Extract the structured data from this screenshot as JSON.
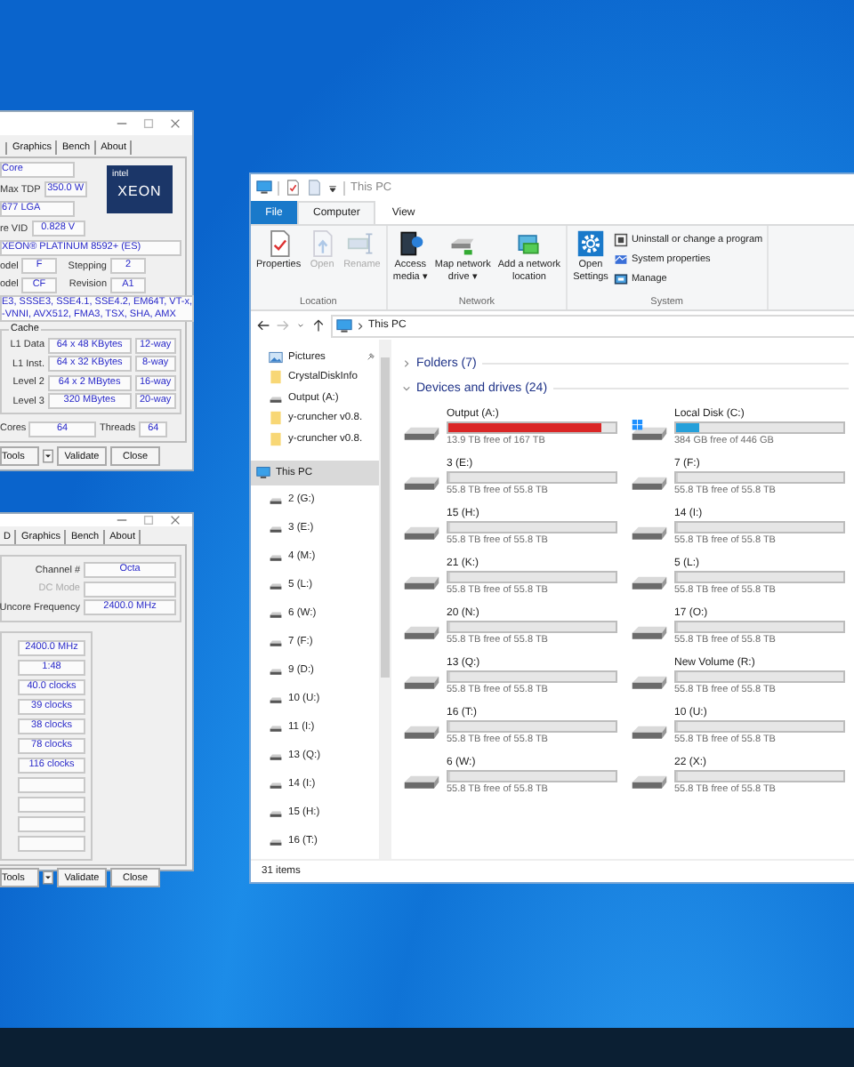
{
  "cpu_window": {
    "tabs": [
      "Graphics",
      "Bench",
      "About"
    ],
    "code_name": "Core",
    "max_tdp": {
      "label": "Max TDP",
      "value": "350.0 W"
    },
    "package": "677 LGA",
    "vid": {
      "label": "re VID",
      "value": "0.828 V"
    },
    "logo": {
      "brand": "intel",
      "name": "XEON"
    },
    "specification": "XEON® PLATINUM 8592+ (ES)",
    "model": {
      "label": "odel",
      "value": "F"
    },
    "stepping": {
      "label": "Stepping",
      "value": "2"
    },
    "ext_model": {
      "label": "odel",
      "value": "CF"
    },
    "revision": {
      "label": "Revision",
      "value": "A1"
    },
    "instructions": [
      "E3, SSSE3, SSE4.1, SSE4.2, EM64T, VT-x,",
      "-VNNI, AVX512, FMA3, TSX, SHA, AMX"
    ],
    "cache": {
      "title": "Cache",
      "rows": [
        {
          "label": "L1 Data",
          "size": "64 x 48 KBytes",
          "ways": "12-way"
        },
        {
          "label": "L1 Inst.",
          "size": "64 x 32 KBytes",
          "ways": "8-way"
        },
        {
          "label": "Level 2",
          "size": "64 x 2 MBytes",
          "ways": "16-way"
        },
        {
          "label": "Level 3",
          "size": "320 MBytes",
          "ways": "20-way"
        }
      ]
    },
    "cores": {
      "label": "Cores",
      "value": "64"
    },
    "threads": {
      "label": "Threads",
      "value": "64"
    },
    "buttons": {
      "tools": "Tools",
      "validate": "Validate",
      "close": "Close"
    }
  },
  "memory_window": {
    "tabs": [
      "D",
      "Graphics",
      "Bench",
      "About"
    ],
    "channel": {
      "label": "Channel #",
      "value": "Octa"
    },
    "dc_mode": {
      "label": "DC Mode",
      "disabled": true
    },
    "uncore": {
      "label": "Uncore Frequency",
      "value": "2400.0 MHz"
    },
    "timings": [
      "2400.0 MHz",
      "1:48",
      "40.0 clocks",
      "39 clocks",
      "38 clocks",
      "78 clocks",
      "116 clocks"
    ],
    "buttons": {
      "tools": "Tools",
      "validate": "Validate",
      "close": "Close"
    }
  },
  "explorer": {
    "title": "This PC",
    "file_tab": "File",
    "tabs": [
      {
        "label": "Computer",
        "selected": true
      },
      {
        "label": "View",
        "selected": false
      }
    ],
    "groups": [
      {
        "name": "Location",
        "commands": [
          {
            "lines": [
              "Properties"
            ],
            "kind": "properties",
            "disabled": false
          },
          {
            "lines": [
              "Open"
            ],
            "kind": "open",
            "disabled": true
          },
          {
            "lines": [
              "Rename"
            ],
            "kind": "rename",
            "disabled": true
          }
        ]
      },
      {
        "name": "Network",
        "commands": [
          {
            "lines": [
              "Access",
              "media ▾"
            ],
            "kind": "media",
            "disabled": false
          },
          {
            "lines": [
              "Map network",
              "drive ▾"
            ],
            "kind": "map",
            "disabled": false
          },
          {
            "lines": [
              "Add a network",
              "location"
            ],
            "kind": "netloc",
            "disabled": false
          }
        ]
      },
      {
        "name": "System",
        "commands": [
          {
            "lines": [
              "Open",
              "Settings"
            ],
            "kind": "settings",
            "disabled": false
          }
        ],
        "small_commands": [
          {
            "label": "Uninstall or change a program",
            "kind": "uninstall"
          },
          {
            "label": "System properties",
            "kind": "sysprops"
          },
          {
            "label": "Manage",
            "kind": "manage"
          }
        ]
      }
    ],
    "address": "This PC",
    "quick_access": [
      {
        "label": "Pictures",
        "kind": "pictures",
        "pinned": true,
        "selected": false
      },
      {
        "label": "CrystalDiskInfo",
        "kind": "folder",
        "pinned": false,
        "selected": false
      },
      {
        "label": "Output (A:)",
        "kind": "drive",
        "pinned": false,
        "selected": false
      },
      {
        "label": "y-cruncher v0.8.",
        "kind": "folder",
        "pinned": false,
        "selected": false
      },
      {
        "label": "y-cruncher v0.8.",
        "kind": "folder",
        "pinned": false,
        "selected": false
      }
    ],
    "this_pc": {
      "label": "This PC",
      "selected": true,
      "children": [
        {
          "label": "2 (G:)",
          "selected": false
        },
        {
          "label": "3 (E:)",
          "selected": false
        },
        {
          "label": "4 (M:)",
          "selected": false
        },
        {
          "label": "5 (L:)",
          "selected": false
        },
        {
          "label": "6 (W:)",
          "selected": false
        },
        {
          "label": "7 (F:)",
          "selected": false
        },
        {
          "label": "9 (D:)",
          "selected": false
        },
        {
          "label": "10 (U:)",
          "selected": false
        },
        {
          "label": "11 (I:)",
          "selected": false
        },
        {
          "label": "13 (Q:)",
          "selected": false
        },
        {
          "label": "14 (I:)",
          "selected": false
        },
        {
          "label": "15 (H:)",
          "selected": false
        },
        {
          "label": "16 (T:)",
          "selected": false
        }
      ]
    },
    "sections": [
      {
        "label": "Folders (7)",
        "expanded": false
      },
      {
        "label": "Devices and drives (24)",
        "expanded": true
      }
    ],
    "drives": [
      {
        "name": "Output (A:)",
        "free": "13.9 TB free of 167 TB",
        "level": 0.92,
        "color": "#da2626",
        "kind": "disk"
      },
      {
        "name": "Local Disk (C:)",
        "free": "384 GB free of 446 GB",
        "level": 0.14,
        "color": "#26a0da",
        "kind": "system"
      },
      {
        "name": "3 (E:)",
        "free": "55.8 TB free of 55.8 TB",
        "level": 0,
        "kind": "disk"
      },
      {
        "name": "7 (F:)",
        "free": "55.8 TB free of 55.8 TB",
        "level": 0,
        "kind": "disk"
      },
      {
        "name": "15 (H:)",
        "free": "55.8 TB free of 55.8 TB",
        "level": 0,
        "kind": "disk"
      },
      {
        "name": "14 (I:)",
        "free": "55.8 TB free of 55.8 TB",
        "level": 0,
        "kind": "disk"
      },
      {
        "name": "21 (K:)",
        "free": "55.8 TB free of 55.8 TB",
        "level": 0,
        "kind": "disk"
      },
      {
        "name": "5 (L:)",
        "free": "55.8 TB free of 55.8 TB",
        "level": 0,
        "kind": "disk"
      },
      {
        "name": "20 (N:)",
        "free": "55.8 TB free of 55.8 TB",
        "level": 0,
        "kind": "disk"
      },
      {
        "name": "17 (O:)",
        "free": "55.8 TB free of 55.8 TB",
        "level": 0,
        "kind": "disk"
      },
      {
        "name": "13 (Q:)",
        "free": "55.8 TB free of 55.8 TB",
        "level": 0,
        "kind": "disk"
      },
      {
        "name": "New Volume (R:)",
        "free": "55.8 TB free of 55.8 TB",
        "level": 0,
        "kind": "disk"
      },
      {
        "name": "16 (T:)",
        "free": "55.8 TB free of 55.8 TB",
        "level": 0,
        "kind": "disk"
      },
      {
        "name": "10 (U:)",
        "free": "55.8 TB free of 55.8 TB",
        "level": 0,
        "kind": "disk"
      },
      {
        "name": "6 (W:)",
        "free": "55.8 TB free of 55.8 TB",
        "level": 0,
        "kind": "disk"
      },
      {
        "name": "22 (X:)",
        "free": "55.8 TB free of 55.8 TB",
        "level": 0,
        "kind": "disk"
      }
    ],
    "status": "31 items"
  }
}
